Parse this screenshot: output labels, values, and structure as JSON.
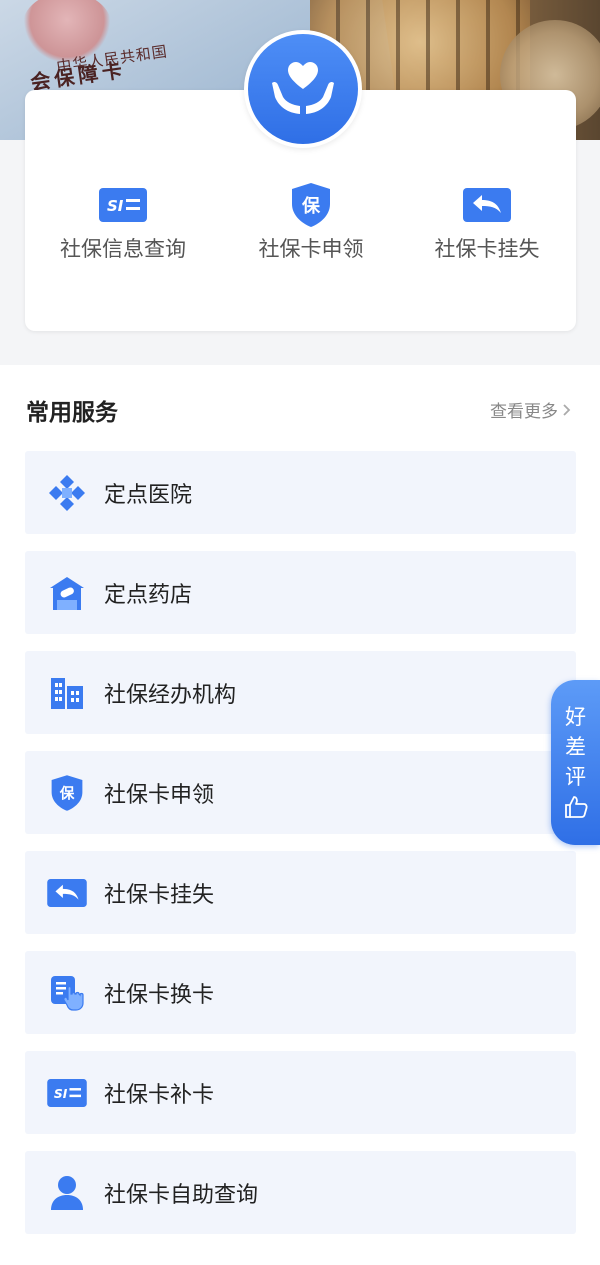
{
  "banner": {
    "card_line1": "中华人民共和国",
    "card_line2": "会保障卡"
  },
  "quick_actions": [
    {
      "label": "社保信息查询",
      "icon": "si-card-icon"
    },
    {
      "label": "社保卡申领",
      "icon": "shield-bao-icon"
    },
    {
      "label": "社保卡挂失",
      "icon": "return-arrow-icon"
    }
  ],
  "shield_char": "保",
  "services": {
    "title": "常用服务",
    "more": "查看更多",
    "items": [
      {
        "label": "定点医院",
        "icon": "hospital-cross-icon"
      },
      {
        "label": "定点药店",
        "icon": "pharmacy-icon"
      },
      {
        "label": "社保经办机构",
        "icon": "building-icon"
      },
      {
        "label": "社保卡申领",
        "icon": "shield-bao-icon"
      },
      {
        "label": "社保卡挂失",
        "icon": "return-arrow-icon"
      },
      {
        "label": "社保卡换卡",
        "icon": "card-hand-icon"
      },
      {
        "label": "社保卡补卡",
        "icon": "si-card-icon"
      },
      {
        "label": "社保卡自助查询",
        "icon": "person-icon"
      }
    ]
  },
  "feedback": {
    "chars": [
      "好",
      "差",
      "评"
    ],
    "icon": "thumb-up-icon"
  },
  "colors": {
    "primary": "#2f6fe6",
    "tile_bg": "#f2f5fc",
    "page_bg": "#f4f5f7"
  }
}
